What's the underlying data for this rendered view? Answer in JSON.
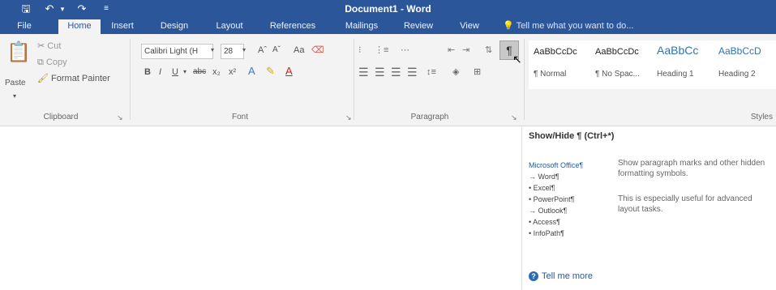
{
  "titlebar": {
    "save_icon": "save-icon",
    "undo_icon": "undo-icon",
    "redo_icon": "redo-icon",
    "customize_icon": "customize-qat-icon",
    "title": "Document1 - Word"
  },
  "tabs": [
    {
      "label": "File"
    },
    {
      "label": "Home"
    },
    {
      "label": "Insert"
    },
    {
      "label": "Design"
    },
    {
      "label": "Layout"
    },
    {
      "label": "References"
    },
    {
      "label": "Mailings"
    },
    {
      "label": "Review"
    },
    {
      "label": "View"
    }
  ],
  "tell_me": "Tell me what you want to do...",
  "clipboard": {
    "paste": "Paste",
    "cut": "Cut",
    "copy": "Copy",
    "format_painter": "Format Painter",
    "group": "Clipboard"
  },
  "font": {
    "font_name": "Calibri Light (H",
    "font_size": "28",
    "grow": "Aˆ",
    "shrink": "Aˇ",
    "case": "Aa",
    "bold": "B",
    "italic": "I",
    "underline": "U",
    "strike": "abc",
    "subscript": "x₂",
    "superscript": "x²",
    "group": "Font"
  },
  "paragraph": {
    "group": "Paragraph",
    "show_hide": "¶"
  },
  "styles": {
    "group": "Styles",
    "items": [
      {
        "preview": "AaBbCcDc",
        "name": "¶ Normal"
      },
      {
        "preview": "AaBbCcDc",
        "name": "¶ No Spac..."
      },
      {
        "preview": "AaBbCc",
        "name": "Heading 1"
      },
      {
        "preview": "AaBbCcD",
        "name": "Heading 2"
      }
    ]
  },
  "tooltip": {
    "title": "Show/Hide ¶ (Ctrl+*)",
    "desc1": "Show paragraph marks and other hidden formatting symbols.",
    "desc2": "This is especially useful for advanced layout tasks.",
    "list_header": "Microsoft Office¶",
    "list_items": [
      "→ Word¶",
      "• Excel¶",
      "• PowerPoint¶",
      "→ Outlook¶",
      "• Access¶",
      "• InfoPath¶"
    ],
    "more": "Tell me more"
  }
}
